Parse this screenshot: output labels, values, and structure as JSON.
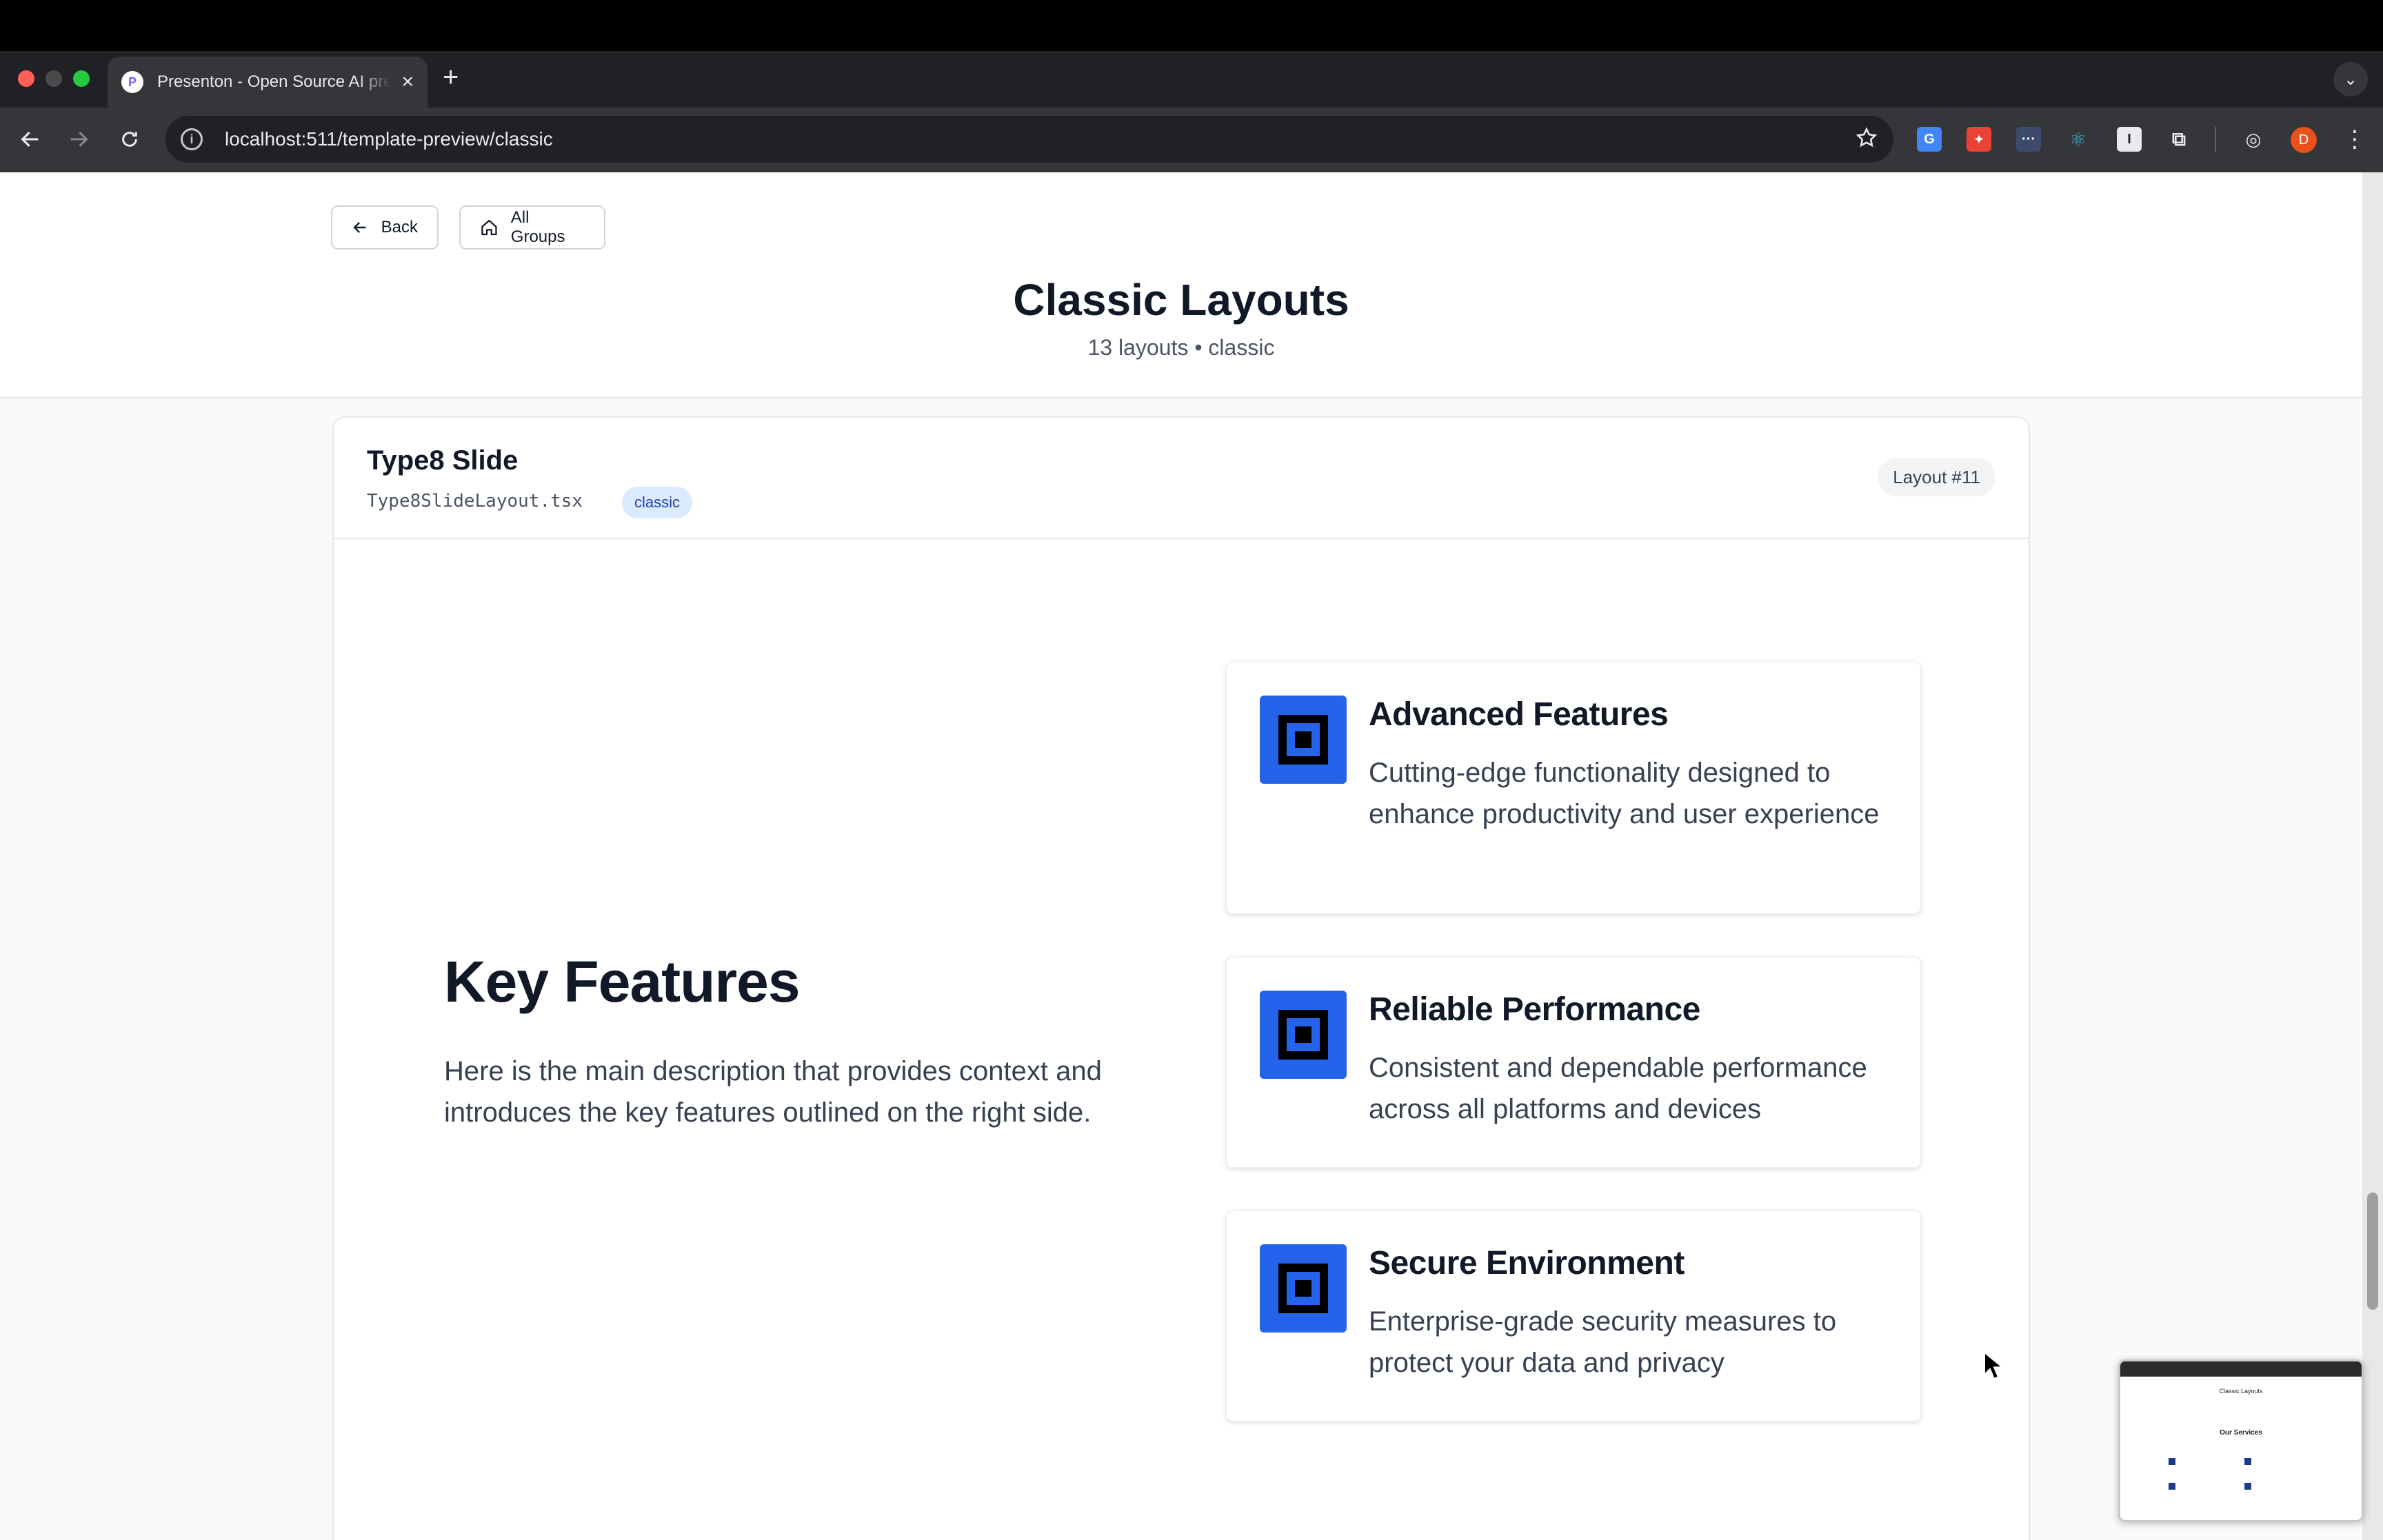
{
  "browser": {
    "tab_title": "Presenton - Open Source AI presentation generator",
    "tab_favicon": "P",
    "url": "localhost:511/template-preview/classic",
    "profile_initial": "D"
  },
  "header": {
    "back_label": "Back",
    "all_groups_label": "All Groups",
    "title": "Classic Layouts",
    "subtitle": "13 layouts • classic"
  },
  "layout_card": {
    "name": "Type8 Slide",
    "file": "Type8SlideLayout.tsx",
    "tag": "classic",
    "layout_number": "Layout #11"
  },
  "slide": {
    "heading": "Key Features",
    "description": "Here is the main description that provides context and introduces the key features outlined on the right side.",
    "features": [
      {
        "title": "Advanced Features",
        "description": "Cutting-edge functionality designed to enhance productivity and user experience"
      },
      {
        "title": "Reliable Performance",
        "description": "Consistent and dependable performance across all platforms and devices"
      },
      {
        "title": "Secure Environment",
        "description": "Enterprise-grade security measures to protect your data and privacy"
      }
    ]
  },
  "thumbnail": {
    "title": "Classic Layouts",
    "heading": "Our Services"
  },
  "colors": {
    "accent": "#2563eb",
    "tag_bg": "#dbeafe",
    "tag_text": "#1e40af"
  }
}
